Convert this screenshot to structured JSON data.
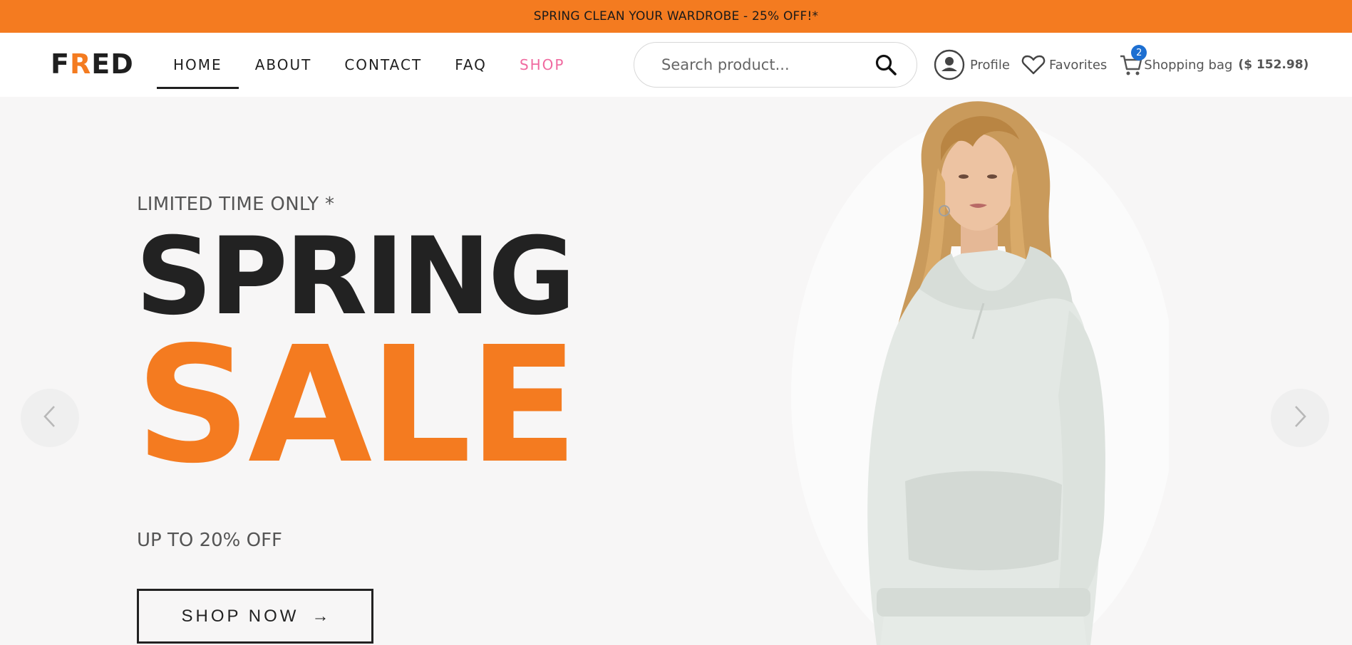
{
  "promo": {
    "text": "SPRING CLEAN YOUR WARDROBE - 25% OFF!*",
    "bg_color": "#F47B20"
  },
  "header": {
    "logo": {
      "part1": "F",
      "part2": "R",
      "part3": "ED"
    },
    "nav": [
      {
        "label": "HOME",
        "active": true
      },
      {
        "label": "ABOUT"
      },
      {
        "label": "CONTACT"
      },
      {
        "label": "FAQ"
      },
      {
        "label": "SHOP"
      }
    ],
    "search": {
      "placeholder": "Search product...",
      "icon": "search-icon"
    },
    "account": {
      "profile_label": "Profile",
      "favorites_label": "Favorites",
      "bag_label": "Shopping bag",
      "bag_total": "($ 152.98)",
      "bag_count": "2"
    }
  },
  "hero": {
    "kicker": "LIMITED TIME ONLY *",
    "headline_1": "SPRING",
    "headline_2": "SALE",
    "subtext": "UP TO 20% OFF",
    "cta_label": "SHOP NOW",
    "cta_arrow": "→",
    "accent_color": "#F47B20",
    "prev_icon": "chevron-left-icon",
    "next_icon": "chevron-right-icon"
  }
}
